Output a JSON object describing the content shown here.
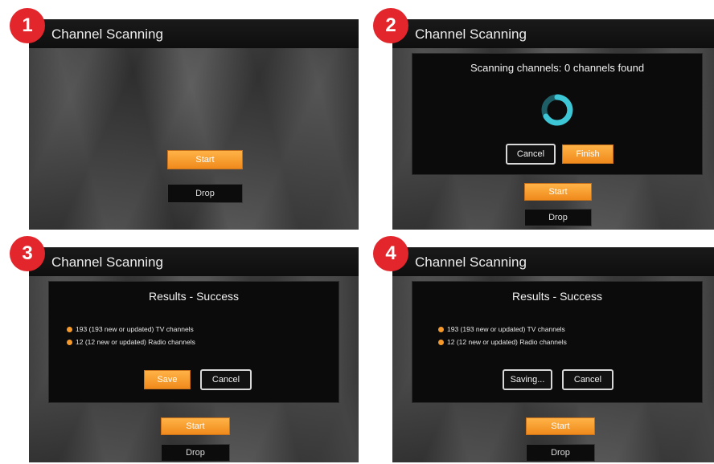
{
  "steps": [
    "1",
    "2",
    "3",
    "4"
  ],
  "panel_title": "Channel Scanning",
  "buttons": {
    "start": "Start",
    "drop": "Drop",
    "cancel": "Cancel",
    "finish": "Finish",
    "save": "Save",
    "saving": "Saving..."
  },
  "scanning": {
    "status": "Scanning channels: 0 channels found",
    "progress_icon": "spinner-icon"
  },
  "results": {
    "title": "Results - Success",
    "tv_line": "193 (193 new or updated) TV channels",
    "radio_line": "12 (12 new or updated) Radio channels"
  },
  "colors": {
    "badge": "#e3252c",
    "accent": "#f08a1c",
    "spinner": "#3cc6d6"
  }
}
